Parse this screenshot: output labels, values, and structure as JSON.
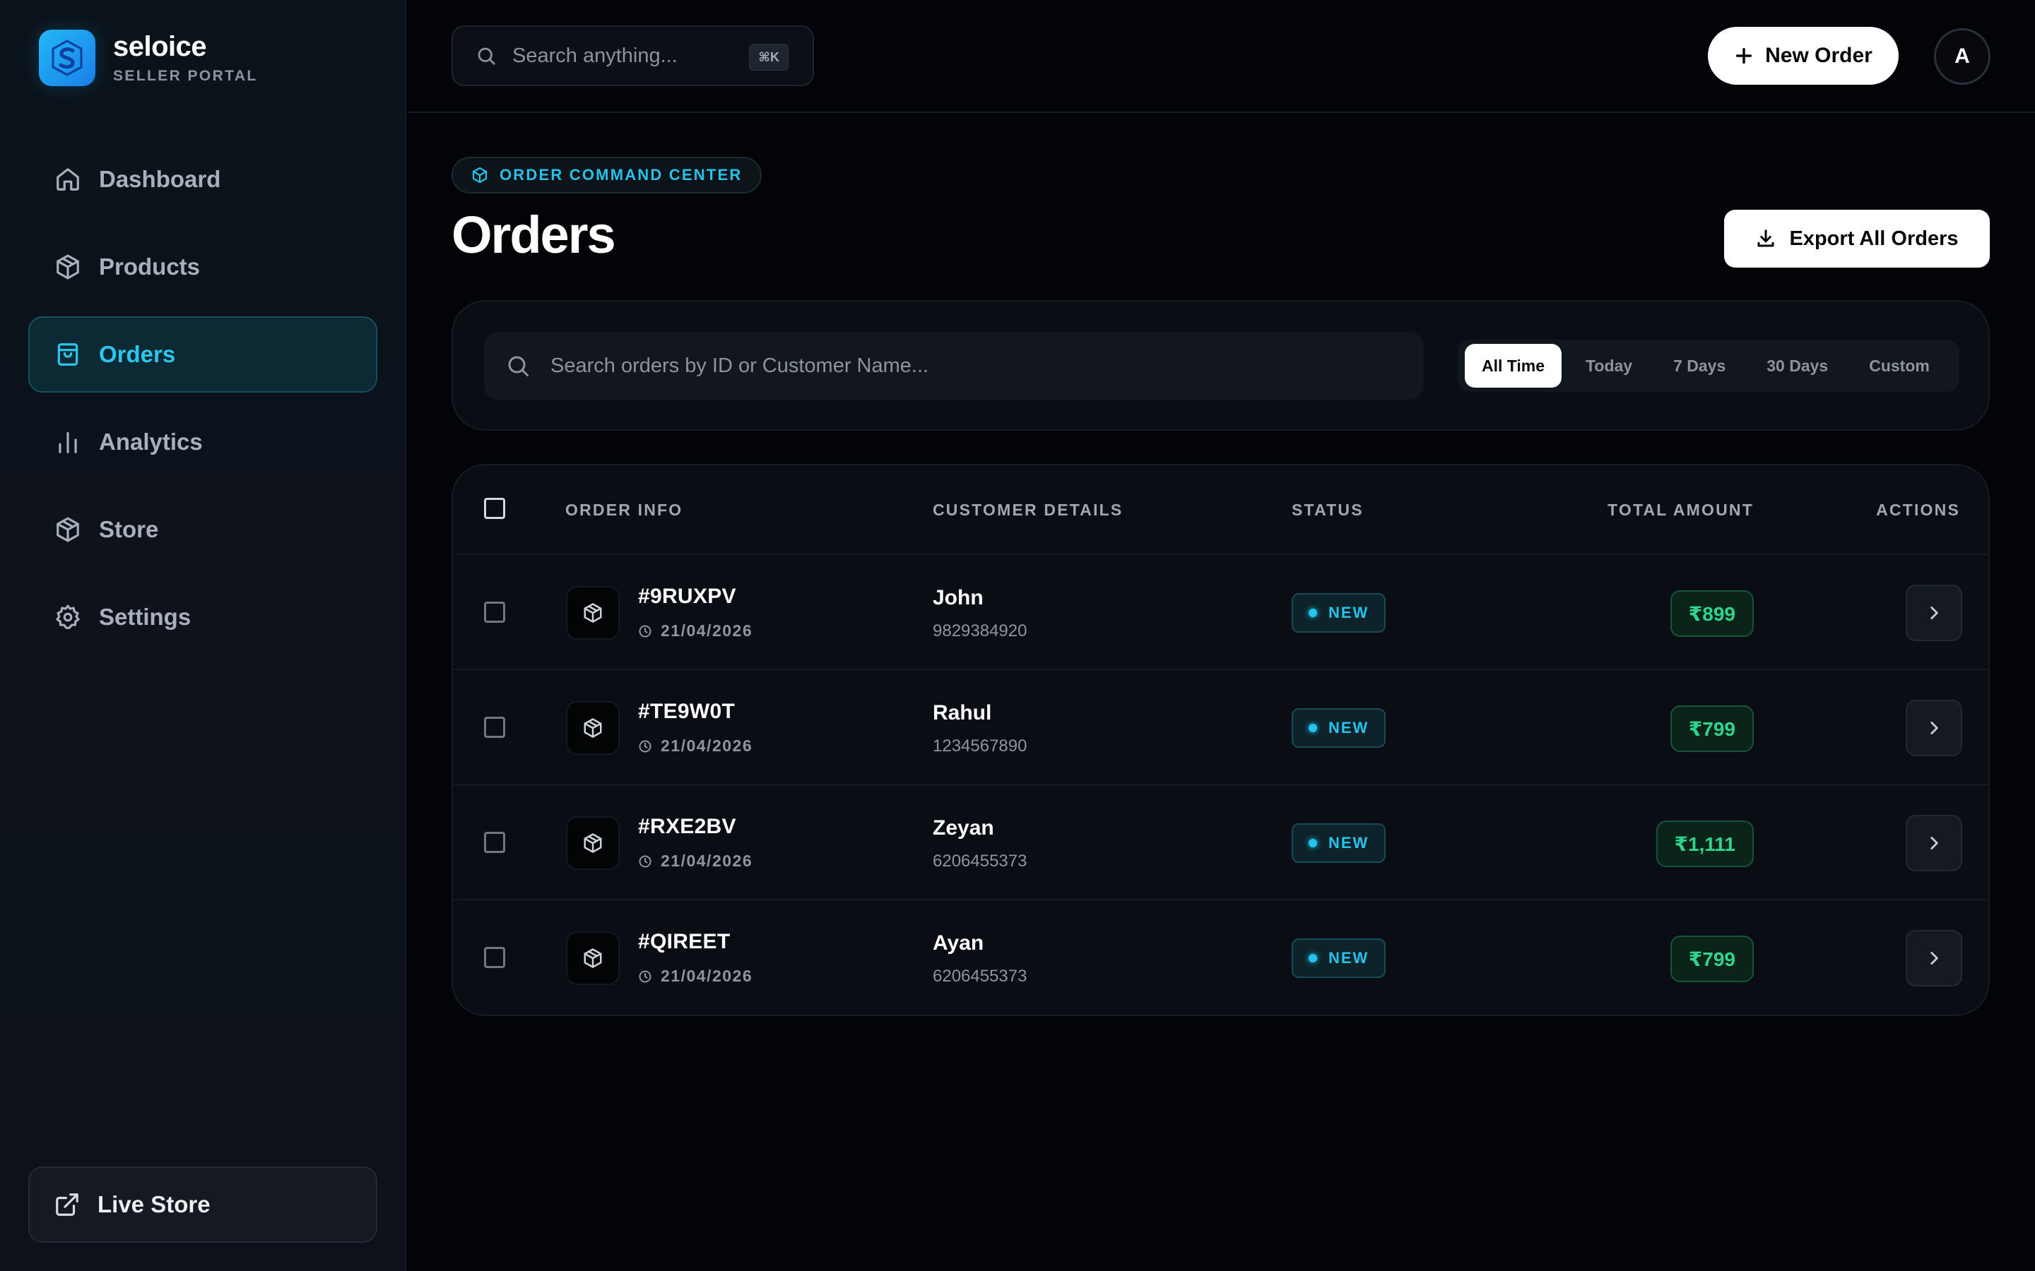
{
  "app": {
    "brand_name": "seloice",
    "brand_sub": "SELLER PORTAL"
  },
  "sidebar": {
    "items": [
      {
        "label": "Dashboard",
        "icon": "home-icon",
        "active": false
      },
      {
        "label": "Products",
        "icon": "box-icon",
        "active": false
      },
      {
        "label": "Orders",
        "icon": "shopping-bag-icon",
        "active": true
      },
      {
        "label": "Analytics",
        "icon": "bar-chart-icon",
        "active": false
      },
      {
        "label": "Store",
        "icon": "box-icon",
        "active": false
      },
      {
        "label": "Settings",
        "icon": "gear-icon",
        "active": false
      }
    ],
    "footer_link": {
      "label": "Live Store",
      "icon": "external-link-icon"
    }
  },
  "topbar": {
    "search_placeholder": "Search anything...",
    "shortcut": "⌘K",
    "new_order_label": "New Order",
    "avatar_initial": "A"
  },
  "header": {
    "badge": "ORDER COMMAND CENTER",
    "title": "Orders",
    "export_label": "Export All Orders"
  },
  "filters": {
    "search_placeholder": "Search orders by ID or Customer Name...",
    "time_tabs": [
      "All Time",
      "Today",
      "7 Days",
      "30 Days",
      "Custom"
    ],
    "active_tab": "All Time"
  },
  "table": {
    "columns": [
      "ORDER INFO",
      "CUSTOMER DETAILS",
      "STATUS",
      "TOTAL AMOUNT",
      "ACTIONS"
    ],
    "rows": [
      {
        "order_id": "#9RUXPV",
        "date": "21/04/2026",
        "customer": "John",
        "phone": "9829384920",
        "status": "NEW",
        "amount": "₹899"
      },
      {
        "order_id": "#TE9W0T",
        "date": "21/04/2026",
        "customer": "Rahul",
        "phone": "1234567890",
        "status": "NEW",
        "amount": "₹799"
      },
      {
        "order_id": "#RXE2BV",
        "date": "21/04/2026",
        "customer": "Zeyan",
        "phone": "6206455373",
        "status": "NEW",
        "amount": "₹1,111"
      },
      {
        "order_id": "#QIREET",
        "date": "21/04/2026",
        "customer": "Ayan",
        "phone": "6206455373",
        "status": "NEW",
        "amount": "₹799"
      }
    ]
  },
  "colors": {
    "accent": "#25c3ec",
    "success": "#2fd48f",
    "background": "#030407",
    "brand_gradient_start": "#22b8f6",
    "brand_gradient_end": "#1a7ee8"
  }
}
